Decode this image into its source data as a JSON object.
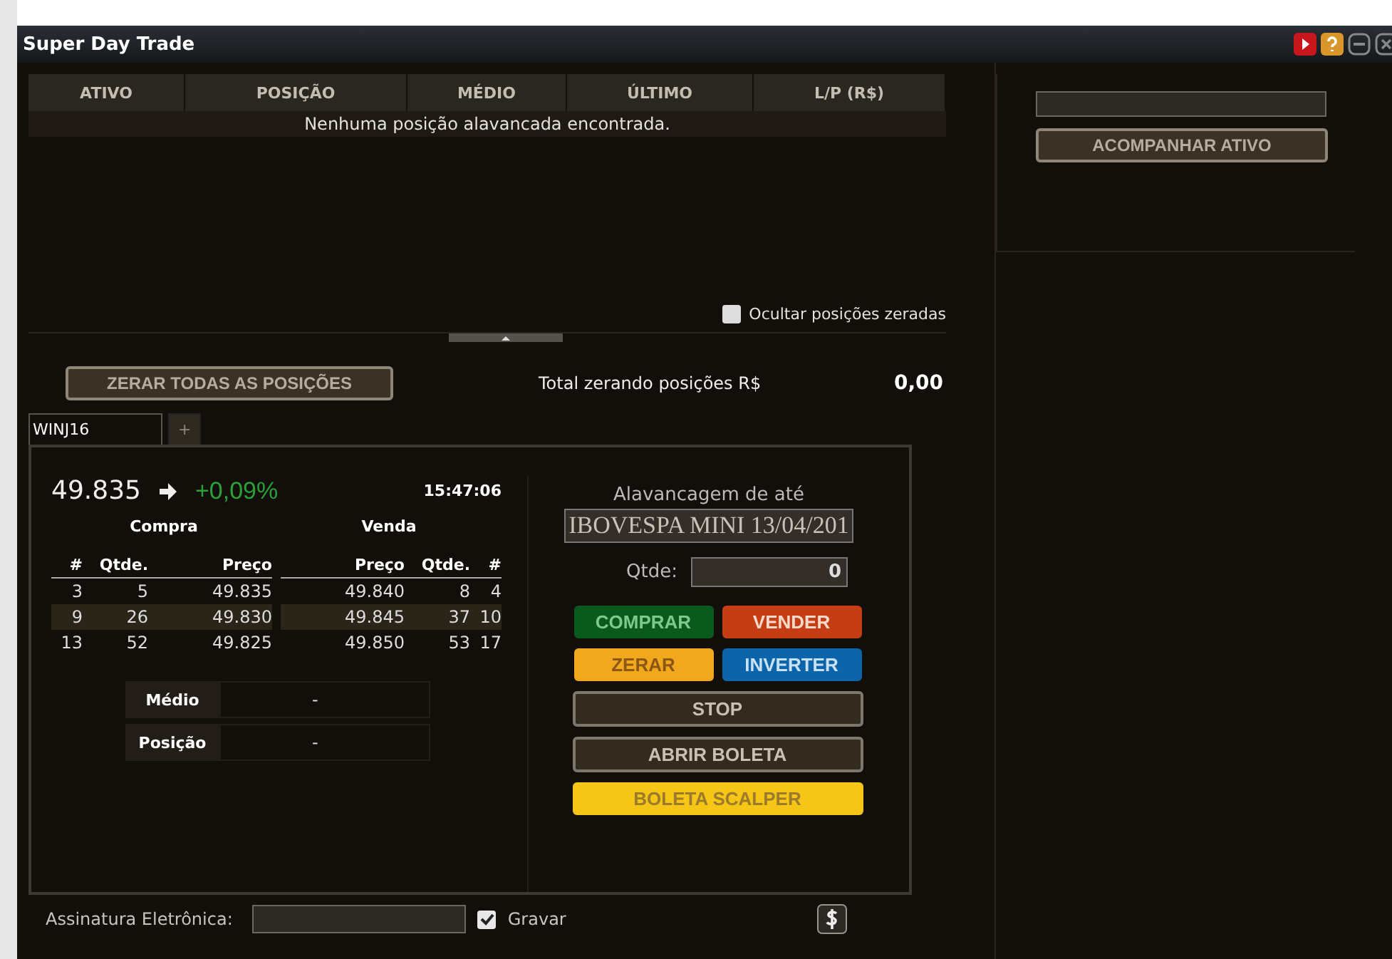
{
  "window": {
    "title": "Super Day Trade"
  },
  "positions": {
    "columns": [
      "ATIVO",
      "POSIÇÃO",
      "MÉDIO",
      "ÚLTIMO",
      "L/P (R$)"
    ],
    "empty_message": "Nenhuma posição alavancada encontrada.",
    "hide_zeroed": {
      "label": "Ocultar posições zeradas",
      "checked": false
    }
  },
  "summary": {
    "zero_all_button": "ZERAR TODAS AS POSIÇÕES",
    "total_label": "Total zerando posições R$",
    "total_value": "0,00"
  },
  "tabs": [
    {
      "label": "WINJ16",
      "selected": true
    }
  ],
  "add_tab": "+",
  "quote": {
    "price": "49.835",
    "change": "+0,09%",
    "time": "15:47:06"
  },
  "book": {
    "buy_title": "Compra",
    "sell_title": "Venda",
    "buy_columns": [
      "#",
      "Qtde.",
      "Preço"
    ],
    "sell_columns": [
      "Preço",
      "Qtde.",
      "#"
    ],
    "rows": [
      {
        "buy": [
          "3",
          "5",
          "49.835"
        ],
        "sell": [
          "49.840",
          "8",
          "4"
        ]
      },
      {
        "buy": [
          "9",
          "26",
          "49.830"
        ],
        "sell": [
          "49.845",
          "37",
          "10"
        ]
      },
      {
        "buy": [
          "13",
          "52",
          "49.825"
        ],
        "sell": [
          "49.850",
          "53",
          "17"
        ]
      }
    ]
  },
  "stats": [
    {
      "label": "Médio",
      "value": "-"
    },
    {
      "label": "Posição",
      "value": "-"
    }
  ],
  "order": {
    "leverage_label": "Alavancagem de até",
    "leverage_value": "IBOVESPA MINI 13/04/201",
    "qty_label": "Qtde:",
    "qty_value": "0",
    "buttons": [
      [
        {
          "label": "COMPRAR",
          "kind": "buy"
        },
        {
          "label": "VENDER",
          "kind": "sell"
        }
      ],
      [
        {
          "label": "ZERAR",
          "kind": "zero"
        },
        {
          "label": "INVERTER",
          "kind": "invert"
        }
      ],
      [
        {
          "label": "STOP",
          "kind": "plain"
        }
      ],
      [
        {
          "label": "ABRIR BOLETA",
          "kind": "plain"
        }
      ],
      [
        {
          "label": "BOLETA SCALPER",
          "kind": "scalper"
        }
      ]
    ]
  },
  "footer": {
    "signature_label": "Assinatura Eletrônica:",
    "save": {
      "label": "Gravar",
      "checked": true
    }
  },
  "watch": {
    "button": "ACOMPANHAR ATIVO"
  }
}
